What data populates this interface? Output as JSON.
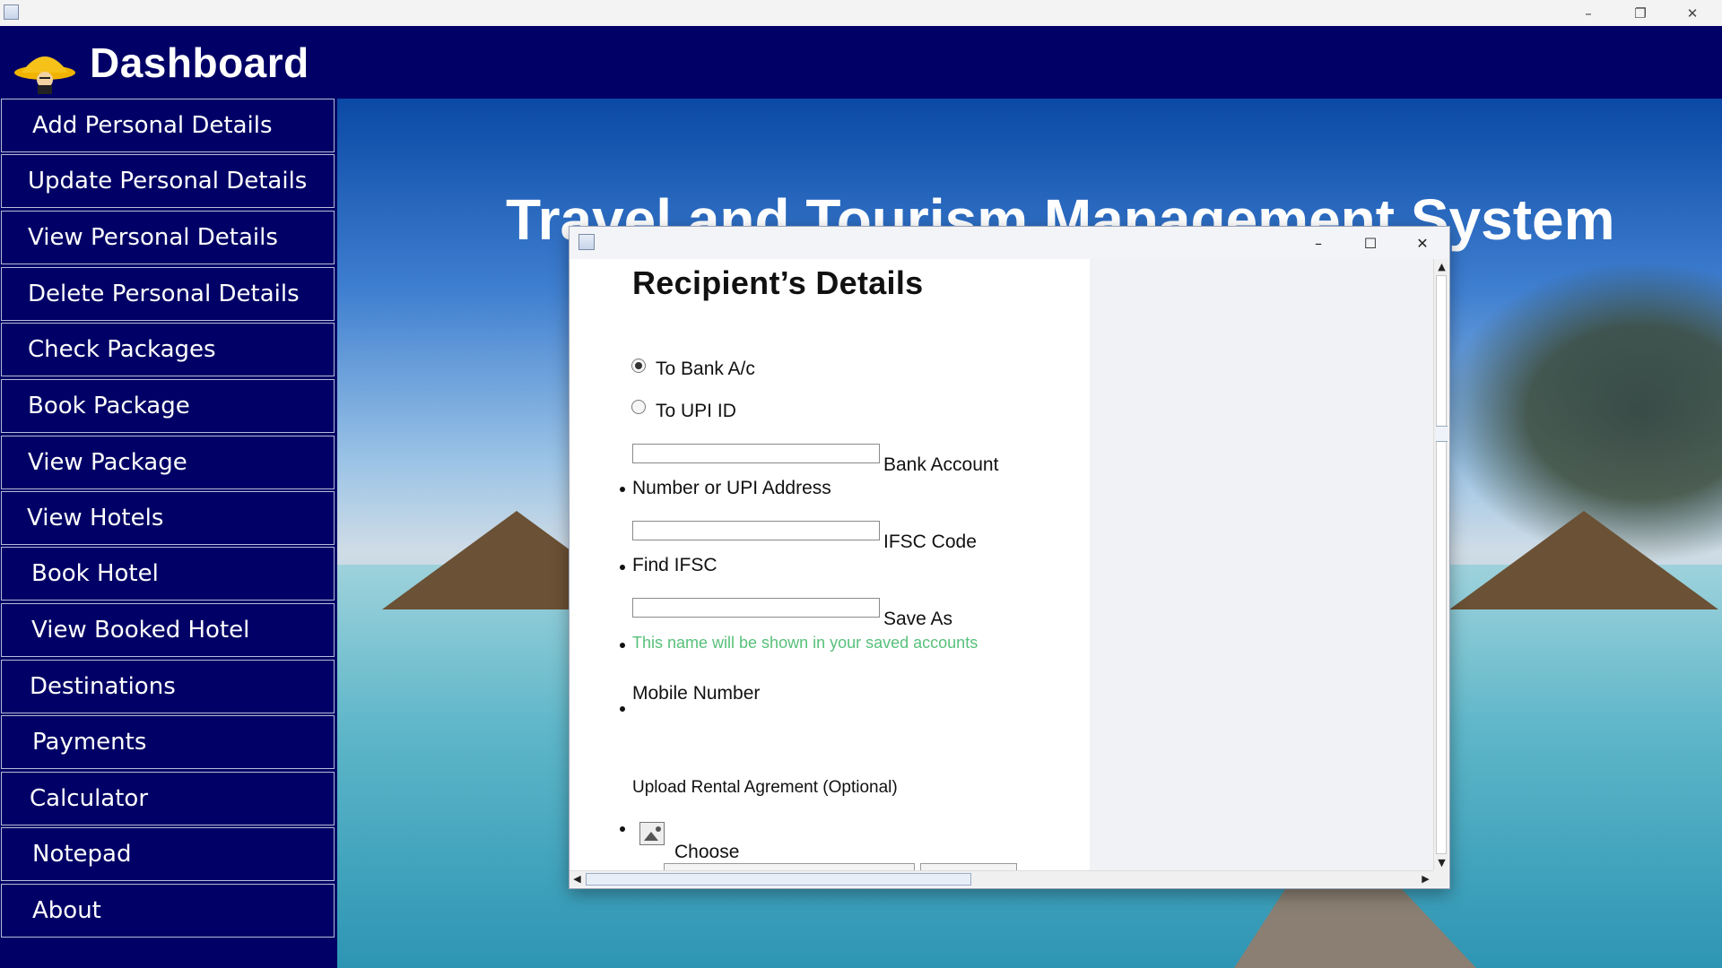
{
  "os_window": {
    "minimize_glyph": "–",
    "restore_glyph": "❐",
    "close_glyph": "✕"
  },
  "header": {
    "title": "Dashboard",
    "logo_icon": "hat-character-logo"
  },
  "sidebar": {
    "items": [
      {
        "label": "Add Personal Details"
      },
      {
        "label": "Update Personal Details"
      },
      {
        "label": "View Personal Details"
      },
      {
        "label": "Delete Personal Details"
      },
      {
        "label": "Check Packages"
      },
      {
        "label": "Book Package"
      },
      {
        "label": "View Package"
      },
      {
        "label": "View Hotels"
      },
      {
        "label": "Book Hotel"
      },
      {
        "label": "View Booked Hotel"
      },
      {
        "label": "Destinations"
      },
      {
        "label": "Payments"
      },
      {
        "label": "Calculator"
      },
      {
        "label": "Notepad"
      },
      {
        "label": "About"
      }
    ]
  },
  "background": {
    "title": "Travel and Tourism Management System"
  },
  "dialog": {
    "minimize_glyph": "–",
    "maximize_glyph": "☐",
    "close_glyph": "✕",
    "heading": "Recipient’s Details",
    "radio_bank": {
      "label": "To Bank A/c",
      "selected": true
    },
    "radio_upi": {
      "label": "To UPI ID",
      "selected": false
    },
    "account_field": {
      "label_right": "Bank Account",
      "label_below": "Number or UPI Address",
      "value": ""
    },
    "ifsc_field": {
      "label_right": "IFSC Code",
      "label_below": "Find IFSC",
      "value": ""
    },
    "save_as_field": {
      "label_right": "Save As",
      "hint": "This name will be shown in your saved accounts",
      "value": ""
    },
    "mobile": {
      "label": "Mobile Number"
    },
    "upload": {
      "label": "Upload Rental Agrement (Optional)",
      "choose_label": "Choose",
      "icon": "image-icon"
    },
    "colors": {
      "hint": "#58c07a"
    }
  },
  "colors": {
    "navy": "#000066",
    "dialog_bg": "#f3f4f7"
  }
}
